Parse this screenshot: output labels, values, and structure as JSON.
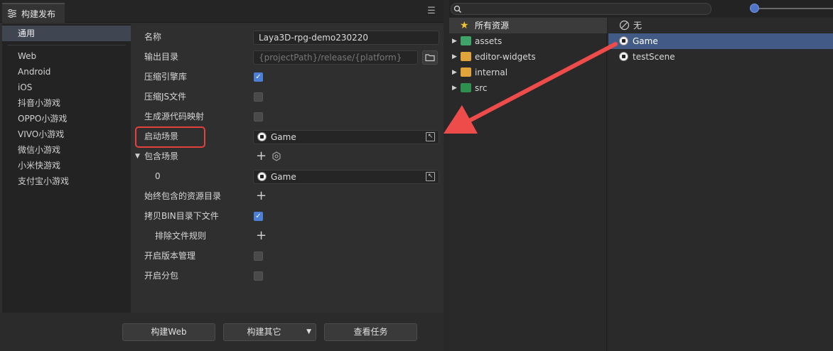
{
  "tab": {
    "title": "构建发布",
    "icon": "settings-sliders-icon"
  },
  "platforms": {
    "selected": "通用",
    "items": [
      "Web",
      "Android",
      "iOS",
      "抖音小游戏",
      "OPPO小游戏",
      "VIVO小游戏",
      "微信小游戏",
      "小米快游戏",
      "支付宝小游戏"
    ]
  },
  "form": {
    "name_label": "名称",
    "name_value": "Laya3D-rpg-demo230220",
    "outdir_label": "输出目录",
    "outdir_placeholder": "{projectPath}/release/{platform}",
    "compress_engine_label": "压缩引擎库",
    "compress_engine_checked": true,
    "compress_js_label": "压缩JS文件",
    "compress_js_checked": false,
    "sourcemap_label": "生成源代码映射",
    "sourcemap_checked": false,
    "start_scene_label": "启动场景",
    "start_scene_value": "Game",
    "include_scenes_label": "包含场景",
    "scene_index": "0",
    "scene0_value": "Game",
    "always_include_label": "始终包含的资源目录",
    "copy_bin_label": "拷贝BIN目录下文件",
    "copy_bin_checked": true,
    "exclude_rules_label": "排除文件规则",
    "version_label": "开启版本管理",
    "version_checked": false,
    "subpackage_label": "开启分包",
    "subpackage_checked": false
  },
  "footer": {
    "build_web": "构建Web",
    "build_other": "构建其它",
    "view_tasks": "查看任务"
  },
  "assets_tree": {
    "root": "所有资源",
    "items": [
      {
        "name": "assets",
        "color": "#3fa46a"
      },
      {
        "name": "editor-widgets",
        "color": "#e0a43a"
      },
      {
        "name": "internal",
        "color": "#e0a43a"
      },
      {
        "name": "src",
        "color": "#2f8f4e"
      }
    ]
  },
  "asset_list": {
    "none_label": "无",
    "items": [
      "Game",
      "testScene"
    ],
    "selected": "Game"
  },
  "colors": {
    "accent": "#4d7fd6",
    "highlight_box": "#e4403c",
    "annotation_arrow": "#ee4b4b"
  }
}
